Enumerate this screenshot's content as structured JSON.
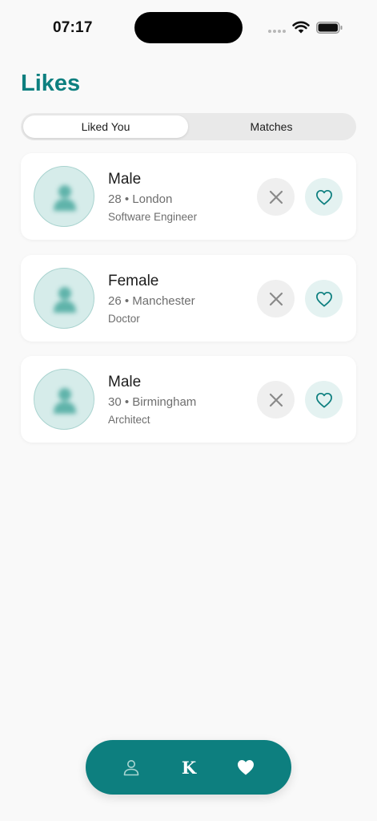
{
  "status_bar": {
    "time": "07:17"
  },
  "header": {
    "title": "Likes"
  },
  "tabs": [
    {
      "label": "Liked You",
      "active": true
    },
    {
      "label": "Matches",
      "active": false
    }
  ],
  "profiles": [
    {
      "gender": "Male",
      "age_location": "28 • London",
      "occupation": "Software Engineer"
    },
    {
      "gender": "Female",
      "age_location": "26 • Manchester",
      "occupation": "Doctor"
    },
    {
      "gender": "Male",
      "age_location": "30 • Birmingham",
      "occupation": "Architect"
    }
  ],
  "actions": {
    "reject_icon": "close-icon",
    "like_icon": "heart-outline-icon"
  },
  "bottom_nav": [
    {
      "icon": "person-icon",
      "active": false
    },
    {
      "icon": "logo-k",
      "label": "K",
      "active": false
    },
    {
      "icon": "heart-icon",
      "active": true
    }
  ],
  "colors": {
    "accent": "#0d7f7f",
    "background": "#f9f9f9",
    "card": "#ffffff",
    "like_bg": "#e4f2f1",
    "reject_bg": "#efefef"
  }
}
